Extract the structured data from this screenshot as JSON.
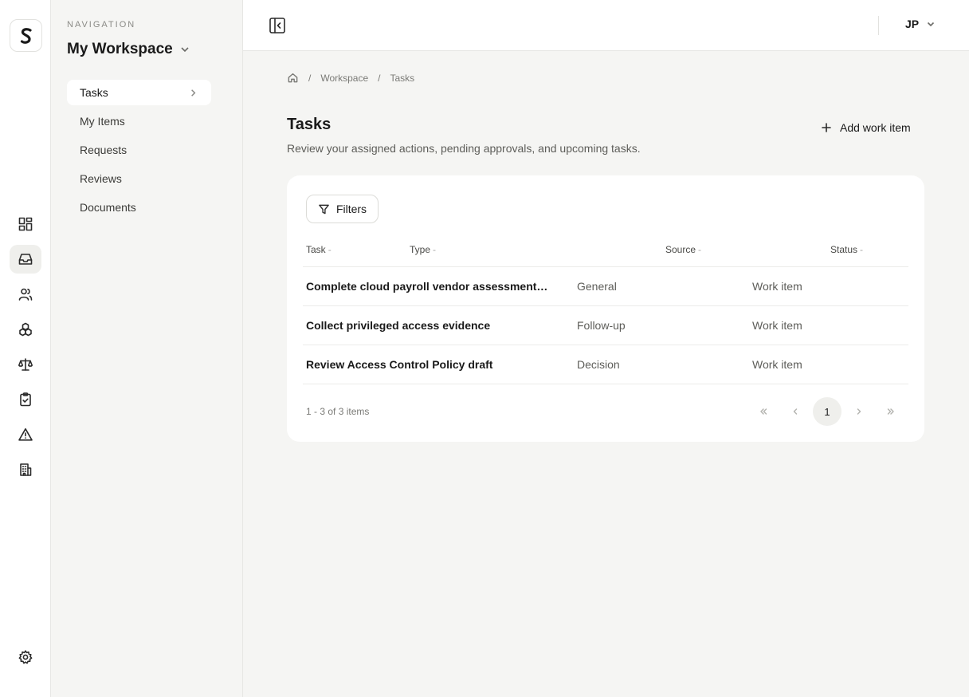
{
  "rail": {
    "logo_icon": "brand-s-logo",
    "items": [
      {
        "icon": "dashboard-grid-icon",
        "active": false
      },
      {
        "icon": "inbox-icon",
        "active": true
      },
      {
        "icon": "users-icon",
        "active": false
      },
      {
        "icon": "cubes-icon",
        "active": false
      },
      {
        "icon": "scales-icon",
        "active": false
      },
      {
        "icon": "clipboard-check-icon",
        "active": false
      },
      {
        "icon": "warning-triangle-icon",
        "active": false
      },
      {
        "icon": "building-icon",
        "active": false
      }
    ],
    "settings_icon": "gear-icon"
  },
  "sidebar": {
    "caption": "NAVIGATION",
    "workspace": "My Workspace",
    "items": [
      {
        "label": "Tasks",
        "active": true
      },
      {
        "label": "My Items",
        "active": false
      },
      {
        "label": "Requests",
        "active": false
      },
      {
        "label": "Reviews",
        "active": false
      },
      {
        "label": "Documents",
        "active": false
      }
    ]
  },
  "topbar": {
    "user_initials": "JP"
  },
  "breadcrumb": [
    "Workspace",
    "Tasks"
  ],
  "page": {
    "title": "Tasks",
    "subtitle": "Review your assigned actions, pending approvals, and upcoming tasks.",
    "add_label": "Add work item"
  },
  "table": {
    "filters_label": "Filters",
    "headers": {
      "task": "Task",
      "type": "Type",
      "source": "Source",
      "status": "Status"
    },
    "sort_glyph": "-",
    "rows": [
      {
        "task": "Complete cloud payroll vendor assessment questionnaire",
        "type": "General",
        "source": "Work item",
        "status": ""
      },
      {
        "task": "Collect privileged access evidence",
        "type": "Follow-up",
        "source": "Work item",
        "status": ""
      },
      {
        "task": "Review Access Control Policy draft",
        "type": "Decision",
        "source": "Work item",
        "status": ""
      }
    ],
    "count": "1 - 3 of 3 items",
    "current_page": "1"
  },
  "colors": {
    "background": "#f5f5f3",
    "surface": "#ffffff",
    "border": "#e7e7e4",
    "text": "#1a1a1a",
    "muted": "#7a7a76"
  }
}
